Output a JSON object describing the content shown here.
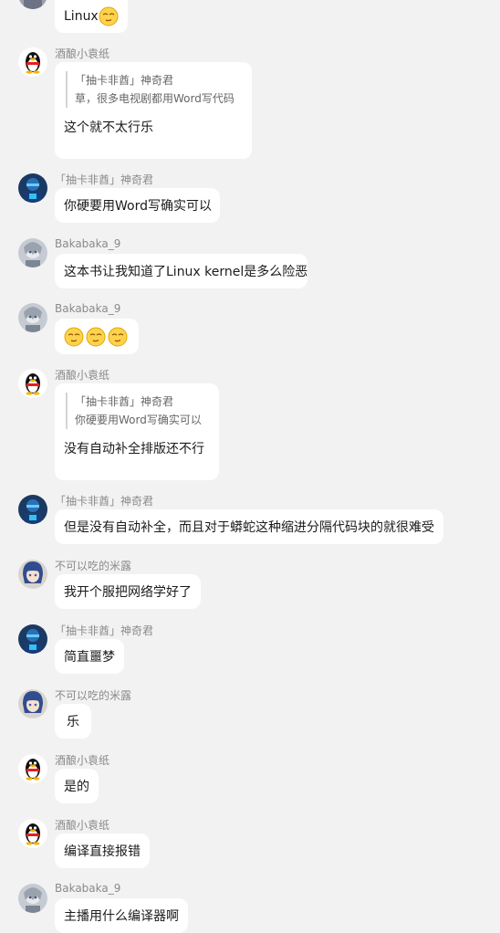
{
  "colors": {
    "background": "#f2f2f2",
    "bubble": "#ffffff",
    "name": "#8a8a8a",
    "emoji": "#ffd24d"
  },
  "messages": [
    {
      "sender": "",
      "avatar": "other",
      "text": "Linux",
      "emoji_count": 1
    },
    {
      "sender": "酒酿小袁纸",
      "avatar": "qq-penguin",
      "quote": {
        "author": "「抽卡非酋」神奇君",
        "text": "草，很多电视剧都用Word写代码"
      },
      "text": "这个就不太行乐"
    },
    {
      "sender": "「抽卡非酋」神奇君",
      "avatar": "blue-character",
      "text": "你硬要用Word写确实可以"
    },
    {
      "sender": "Bakabaka_9",
      "avatar": "anime-grey",
      "text": "这本书让我知道了Linux kernel是多么险恶"
    },
    {
      "sender": "Bakabaka_9",
      "avatar": "anime-grey",
      "text": "",
      "emoji_count": 3
    },
    {
      "sender": "酒酿小袁纸",
      "avatar": "qq-penguin",
      "quote": {
        "author": "「抽卡非酋」神奇君",
        "text": "你硬要用Word写确实可以"
      },
      "text": "没有自动补全排版还不行"
    },
    {
      "sender": "「抽卡非酋」神奇君",
      "avatar": "blue-character",
      "text": "但是没有自动补全，而且对于蟒蛇这种缩进分隔代码块的就很难受"
    },
    {
      "sender": "不可以吃的米露",
      "avatar": "anime-bluehair",
      "text": "我开个服把网络学好了"
    },
    {
      "sender": "「抽卡非酋」神奇君",
      "avatar": "blue-character",
      "text": "简直噩梦"
    },
    {
      "sender": "不可以吃的米露",
      "avatar": "anime-bluehair",
      "text": "乐"
    },
    {
      "sender": "酒酿小袁纸",
      "avatar": "qq-penguin",
      "text": "是的"
    },
    {
      "sender": "酒酿小袁纸",
      "avatar": "qq-penguin",
      "text": "编译直接报错"
    },
    {
      "sender": "Bakabaka_9",
      "avatar": "anime-grey",
      "text": "主播用什么编译器啊"
    }
  ]
}
